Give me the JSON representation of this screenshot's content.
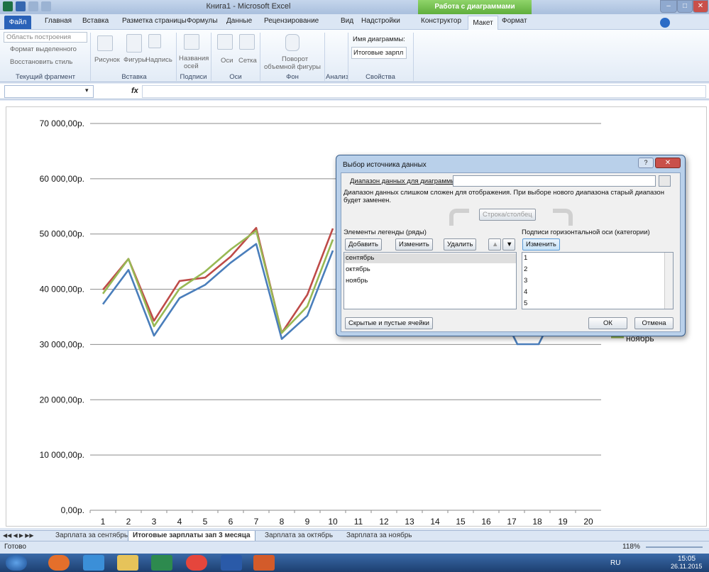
{
  "window": {
    "title": "Книга1 - Microsoft Excel",
    "context_band": "Работа с диаграммами"
  },
  "tabs": [
    "Файл",
    "Главная",
    "Вставка",
    "Разметка страницы",
    "Формулы",
    "Данные",
    "Рецензирование",
    "Вид",
    "Надстройки",
    "Конструктор",
    "Макет",
    "Формат"
  ],
  "ribbon": {
    "fragment": {
      "dropdown": "Область построения",
      "format_selected": "Формат выделенного",
      "restore_style": "Восстановить стиль",
      "label": "Текущий фрагмент"
    },
    "insert": {
      "picture": "Рисунок",
      "shapes": "Фигуры",
      "textbox": "Надпись",
      "label": "Вставка"
    },
    "captions": {
      "axis_titles": "Названия",
      "axis_titles2": "осей",
      "label": "Подписи"
    },
    "axes": {
      "axes": "Оси",
      "grid": "Сетка",
      "label": "Оси"
    },
    "background": {
      "rotation": "Поворот",
      "rotation2": "объемной фигуры",
      "label": "Фон"
    },
    "analysis": {
      "label": "Анализ"
    },
    "properties": {
      "chart_name_label": "Имя диаграммы:",
      "chart_name_value": "Итоговые зарпл",
      "label": "Свойства"
    }
  },
  "formula": {
    "fx": "fx"
  },
  "chart_data": {
    "type": "line",
    "categories": [
      "1",
      "2",
      "3",
      "4",
      "5",
      "6",
      "7",
      "8",
      "9",
      "10",
      "11",
      "12",
      "13",
      "14",
      "15",
      "16",
      "17",
      "18",
      "19",
      "20"
    ],
    "ylim": [
      0,
      70000
    ],
    "yticks": [
      "70 000,00р.",
      "60 000,00р.",
      "50 000,00р.",
      "40 000,00р.",
      "30 000,00р.",
      "20 000,00р.",
      "10 000,00р.",
      "0,00р."
    ],
    "series": [
      {
        "name": "сентябрь",
        "color": "#4a7ebb",
        "values": [
          37300,
          43500,
          31600,
          38400,
          40800,
          44800,
          48200,
          31000,
          35200,
          47000,
          null,
          null,
          null,
          null,
          null,
          null,
          null,
          null,
          null,
          null
        ]
      },
      {
        "name": "октябрь",
        "color": "#be4b48",
        "values": [
          39900,
          45500,
          34300,
          41500,
          42100,
          45900,
          51100,
          32100,
          39000,
          51000,
          null,
          null,
          null,
          null,
          null,
          null,
          null,
          null,
          null,
          null
        ]
      },
      {
        "name": "ноябрь",
        "color": "#98b954",
        "values": [
          39200,
          45500,
          33300,
          40100,
          43200,
          47200,
          50600,
          32100,
          36900,
          49000,
          null,
          null,
          null,
          null,
          null,
          null,
          null,
          null,
          null,
          null
        ]
      }
    ],
    "legend_visible": "ноябрь"
  },
  "dialog": {
    "title": "Выбор источника данных",
    "range_label": "Диапазон данных для диаграммы:",
    "range_value": "",
    "note": "Диапазон данных слишком сложен для отображения. При выборе нового диапазона старый диапазон будет заменен.",
    "switch": "Строка/столбец",
    "legend_label": "Элементы легенды (ряды)",
    "add": "Добавить",
    "edit": "Изменить",
    "delete": "Удалить",
    "axis_label": "Подписи горизонтальной оси (категории)",
    "axis_edit": "Изменить",
    "series_items": [
      "сентябрь",
      "октябрь",
      "ноябрь"
    ],
    "category_items": [
      "1",
      "2",
      "3",
      "4",
      "5"
    ],
    "hidden_cells": "Скрытые и пустые ячейки",
    "ok": "ОК",
    "cancel": "Отмена"
  },
  "sheets": [
    "Зарплата за сентябрь",
    "Итоговые зарплаты зап 3 месяца",
    "Зарплата за октябрь",
    "Зарплата за ноябрь"
  ],
  "status": {
    "ready": "Готово",
    "zoom": "118%"
  },
  "taskbar": {
    "lang": "RU",
    "time": "15:05",
    "date": "26.11.2015"
  }
}
